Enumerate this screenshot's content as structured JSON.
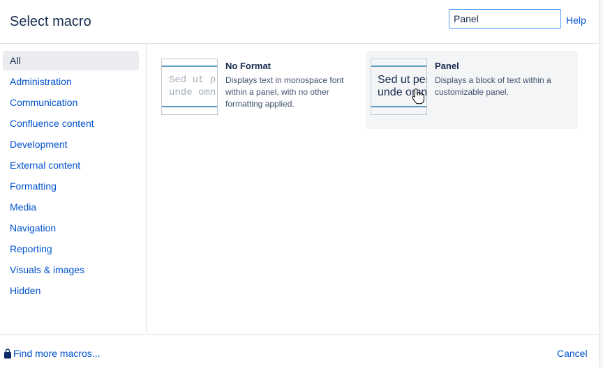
{
  "header": {
    "title": "Select macro",
    "search_value": "Panel",
    "help_label": "Help"
  },
  "sidebar": {
    "items": [
      {
        "label": "All",
        "active": true
      },
      {
        "label": "Administration"
      },
      {
        "label": "Communication"
      },
      {
        "label": "Confluence content"
      },
      {
        "label": "Development"
      },
      {
        "label": "External content"
      },
      {
        "label": "Formatting"
      },
      {
        "label": "Media"
      },
      {
        "label": "Navigation"
      },
      {
        "label": "Reporting"
      },
      {
        "label": "Visuals & images"
      },
      {
        "label": "Hidden"
      }
    ]
  },
  "macros": [
    {
      "name": "No Format",
      "description": "Displays text in monospace font within a panel, with no other formatting applied.",
      "preview": "Sed ut p\nunde omn"
    },
    {
      "name": "Panel",
      "description": "Displays a block of text within a customizable panel.",
      "preview": "Sed ut per\nunde omn"
    }
  ],
  "footer": {
    "find_more_label": "Find more macros...",
    "cancel_label": "Cancel"
  },
  "colors": {
    "link": "#0052cc",
    "accent_line": "#5b9ac4",
    "focus_border": "#4c9aff"
  },
  "icons": {
    "find_more": "shopping-bag-icon",
    "cursor": "hand-pointer-icon"
  }
}
